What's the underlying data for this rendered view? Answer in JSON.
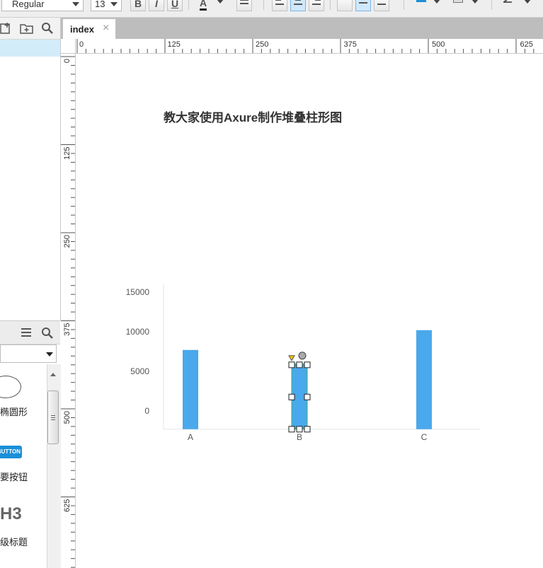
{
  "toolbar": {
    "font_style": "Regular",
    "font_size": "13",
    "bold_label": "B",
    "italic_label": "I",
    "underline_label": "U",
    "font_color_label": "A",
    "fill_color": "#1a8fd8"
  },
  "tab": {
    "label": "index",
    "close": "×"
  },
  "ruler_h": [
    "0",
    "125",
    "250",
    "375",
    "500",
    "625"
  ],
  "ruler_v": [
    "0",
    "125",
    "250",
    "375",
    "500",
    "625"
  ],
  "library": {
    "items": [
      {
        "label": "椭圆形"
      },
      {
        "label": "要按钮",
        "badge": "BUTTON"
      },
      {
        "label": "级标题",
        "badge": "H3"
      }
    ]
  },
  "canvas": {
    "title": "教大家使用Axure制作堆叠柱形图"
  },
  "chart_data": {
    "type": "bar",
    "categories": [
      "A",
      "B",
      "C"
    ],
    "values": [
      7700,
      6000,
      10200
    ],
    "yticks": [
      15000,
      10000,
      5000,
      0
    ],
    "ylim": [
      -2300,
      18000
    ],
    "bar_color": "#4aa8ec",
    "selected_index": 1,
    "title": "",
    "xlabel": "",
    "ylabel": ""
  }
}
